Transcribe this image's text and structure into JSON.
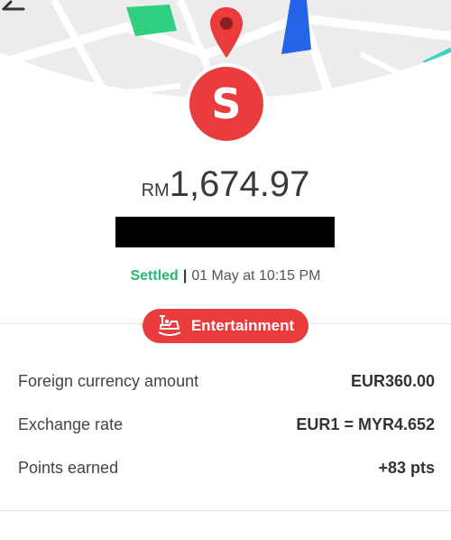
{
  "merchant": {
    "avatar_letter": "S",
    "currency": "RM",
    "amount": "1,674.97"
  },
  "status": {
    "state": "Settled",
    "separator": "|",
    "datetime": "01 May at 10:15 PM"
  },
  "category": {
    "label": "Entertainment",
    "icon": "bumper-car-icon"
  },
  "details": [
    {
      "label": "Foreign currency amount",
      "value": "EUR360.00"
    },
    {
      "label": "Exchange rate",
      "value": "EUR1 = MYR4.652"
    },
    {
      "label": "Points earned",
      "value": "+83 pts"
    }
  ],
  "colors": {
    "accent": "#ea3c3c",
    "settled": "#2bb673"
  }
}
